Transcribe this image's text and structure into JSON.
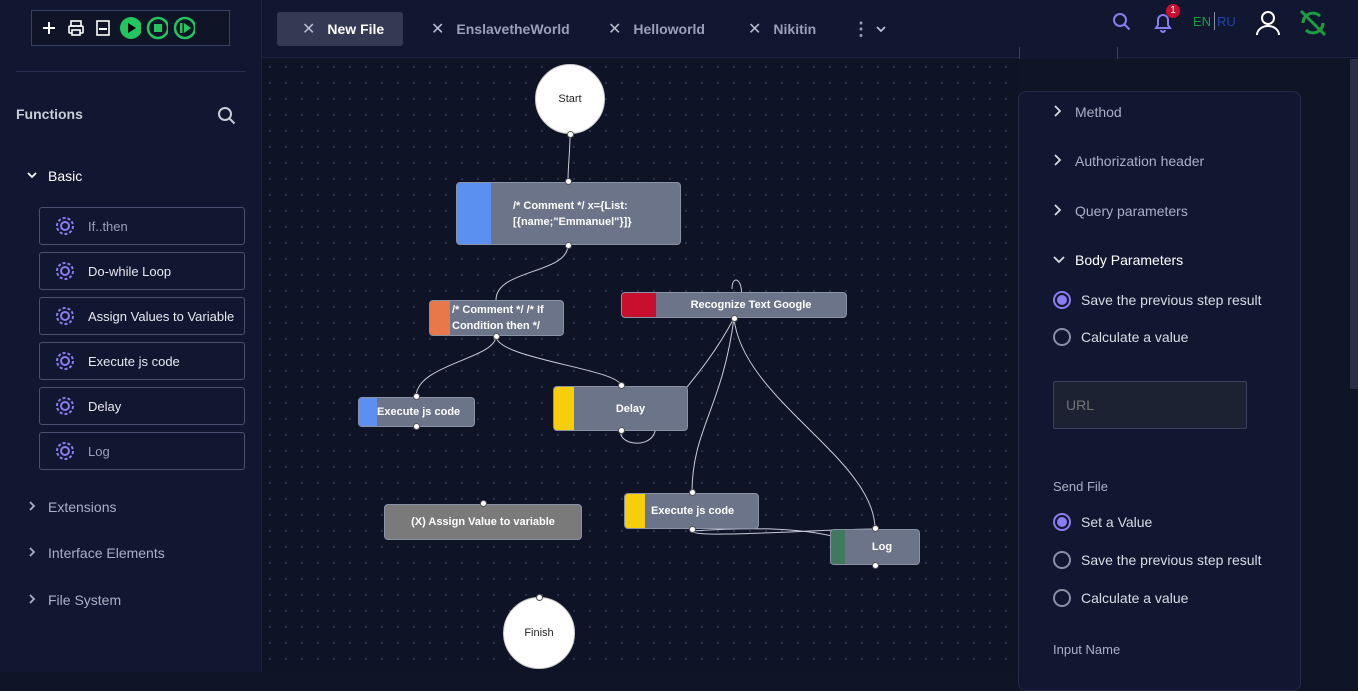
{
  "toolbar": {
    "icons": [
      "plus-icon",
      "print-icon",
      "pdf-icon",
      "play-icon",
      "stop-icon",
      "step-icon"
    ]
  },
  "sidebar": {
    "title": "Functions",
    "basic_label": "Basic",
    "functions": [
      "If..then",
      "Do-while Loop",
      "Assign Values to Variable",
      "Execute js code",
      "Delay",
      "Log"
    ],
    "categories": [
      "Extensions",
      "Interface Elements",
      "File System"
    ]
  },
  "tabs": [
    "New File",
    "EnslavetheWorld",
    "Helloworld",
    "Nikitin"
  ],
  "header": {
    "notification_count": "1",
    "lang_en": "EN",
    "lang_ru": "RU"
  },
  "nodes": {
    "start": "Start",
    "comment1": "/* Comment */ x={List: [{name;\"Emmanuel\"}]}",
    "comment2": "/* Comment */ /* If Condition then */",
    "recognize": "Recognize Text Google",
    "exec1": "Execute js code",
    "delay": "Delay",
    "assign": "(X) Assign Value to variable",
    "exec2": "Execute js code",
    "log": "Log",
    "finish": "Finish"
  },
  "panel": {
    "method": "Method",
    "auth": "Authorization header",
    "query": "Query parameters",
    "body": "Body Parameters",
    "body_opt1": "Save the previous step result",
    "body_opt2": "Calculate a value",
    "url_placeholder": "URL",
    "send_file": "Send File",
    "sf_opt1": "Set a Value",
    "sf_opt2": "Save the previous step result",
    "sf_opt3": "Calculate a value",
    "input_name": "Input Name"
  },
  "colors": {
    "accent": "#8b7cf0",
    "green": "#22c55e",
    "node_blue": "#5b8ff0",
    "node_orange": "#e8784a",
    "node_red": "#c8102e",
    "node_yellow": "#f6cf0a",
    "node_green": "#3f7a5f"
  }
}
